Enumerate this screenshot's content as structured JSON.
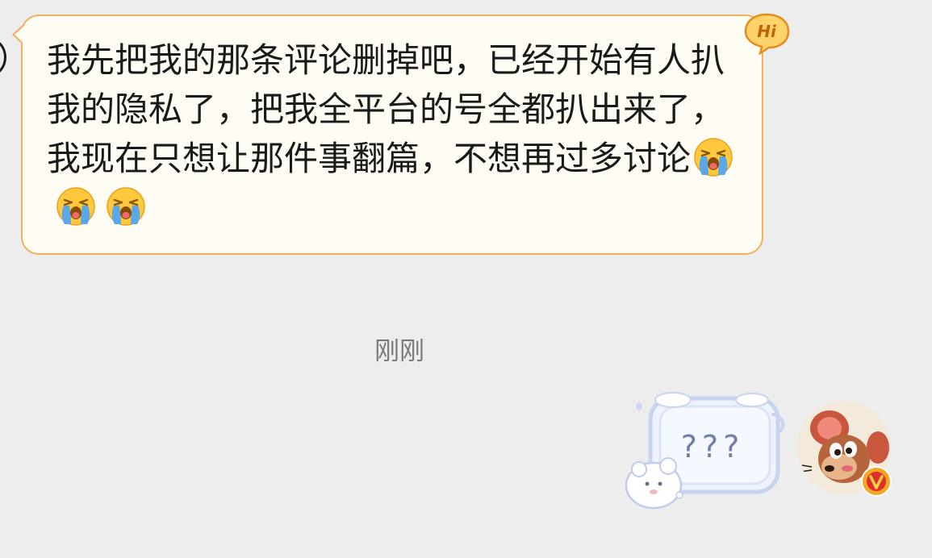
{
  "conversation": {
    "incoming_message": {
      "text": "我先把我的那条评论删掉吧，已经开始有人扒我的隐私了，把我全平台的号全都扒出来了，我现在只想让那件事翻篇，不想再过多讨论",
      "emojis": [
        "loudly-crying-face",
        "loudly-crying-face",
        "loudly-crying-face"
      ],
      "badge": "Hi"
    },
    "timestamp": "刚刚",
    "outgoing_sticker": {
      "text": "???"
    }
  },
  "colors": {
    "background": "#ededed",
    "bubble_fill": "#fffcf3",
    "bubble_border": "#f0b15f",
    "timestamp": "#7a7a7a",
    "sticker_text": "#6f7fa8"
  }
}
